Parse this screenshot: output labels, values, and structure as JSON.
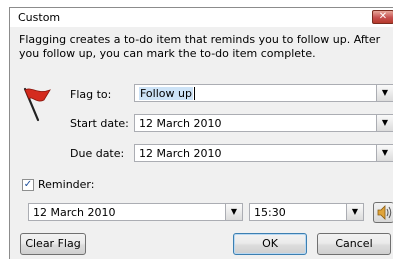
{
  "dialog": {
    "title": "Custom",
    "close_symbol": "✕",
    "description": "Flagging creates a to-do item that reminds you to follow up. After you follow up, you can mark the to-do item complete."
  },
  "flag_to": {
    "label": "Flag to:",
    "value": "Follow up"
  },
  "start_date": {
    "label": "Start date:",
    "value": "12 March 2010"
  },
  "due_date": {
    "label": "Due date:",
    "value": "12 March 2010"
  },
  "reminder": {
    "label": "Reminder:",
    "checked": true,
    "date_value": "12 March 2010",
    "time_value": "15:30"
  },
  "buttons": {
    "clear_flag": "Clear Flag",
    "ok": "OK",
    "cancel": "Cancel"
  },
  "icons": {
    "flag": "red-flag-icon",
    "dropdown": "chevron-down-icon",
    "sound": "speaker-icon",
    "check": "checkmark-icon"
  },
  "colors": {
    "flag_red": "#d42b1e",
    "selection": "#cde3f7",
    "close_red": "#c75050"
  }
}
